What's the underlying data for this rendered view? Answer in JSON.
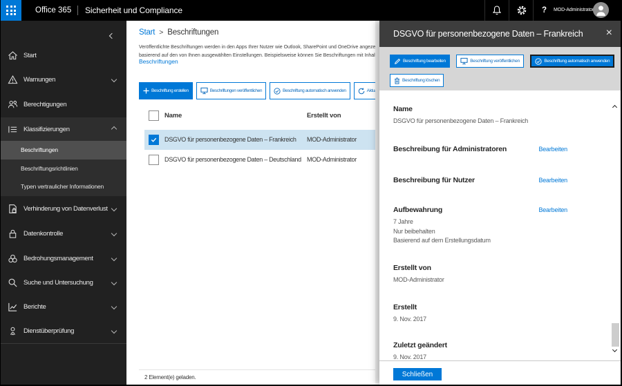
{
  "topbar": {
    "brand": "Office 365",
    "app_title": "Sicherheit und Compliance",
    "user_name": "MOD-Administrator",
    "help_label": "?"
  },
  "sidebar": {
    "items": [
      {
        "label": "Start"
      },
      {
        "label": "Warnungen"
      },
      {
        "label": "Berechtigungen"
      },
      {
        "label": "Klassifizierungen",
        "children": [
          {
            "label": "Beschriftungen"
          },
          {
            "label": "Beschriftungsrichtlinien"
          },
          {
            "label": "Typen vertraulicher Informationen"
          }
        ]
      },
      {
        "label": "Verhinderung von Datenverlust"
      },
      {
        "label": "Datenkontrolle"
      },
      {
        "label": "Bedrohungsmanagement"
      },
      {
        "label": "Suche und Untersuchung"
      },
      {
        "label": "Berichte"
      },
      {
        "label": "Dienstüberprüfung"
      }
    ]
  },
  "main": {
    "breadcrumb": {
      "home": "Start",
      "separator": ">",
      "current": "Beschriftungen"
    },
    "description_line1": "Veröffentlichte Beschriftungen werden in den Apps Ihrer Nutzer wie Outlook, SharePoint und OneDrive angezei",
    "description_line2": "basierend auf den von Ihnen ausgewählten Einstellungen. Beispielsweise können Sie Beschriftungen mit Inhalte",
    "learn_more_link": "Beschriftungen",
    "toolbar": {
      "create_label": "Beschriftung erstellen",
      "publish_label": "Beschriftungen veröffentlichen",
      "auto_apply_label": "Beschriftung automatisch anwenden",
      "refresh_label": "Aktualisieren"
    },
    "table": {
      "columns": [
        "Name",
        "Erstellt von"
      ],
      "rows": [
        {
          "name": "DSGVO für personenbezogene Daten – Frankreich",
          "created_by": "MOD-Administrator"
        },
        {
          "name": "DSGVO für personenbezogene Daten – Deutschland",
          "created_by": "MOD-Administrator"
        }
      ]
    },
    "status_text": "2 Element(e) geladen."
  },
  "panel": {
    "title": "DSGVO für personenbezogene Daten – Frankreich",
    "toolbar": {
      "edit_label": "Beschriftung bearbeiten",
      "publish_label": "Beschriftung veröffentlichen",
      "auto_apply_label": "Beschriftung automatisch anwenden",
      "delete_label": "Beschriftung löschen"
    },
    "sections": {
      "name": {
        "label": "Name",
        "value": "DSGVO für personenbezogene Daten – Frankreich"
      },
      "admin_desc": {
        "label": "Beschreibung für Administratoren",
        "action": "Bearbeiten"
      },
      "user_desc": {
        "label": "Beschreibung für Nutzer",
        "action": "Bearbeiten"
      },
      "retention": {
        "label": "Aufbewahrung",
        "action": "Bearbeiten",
        "line1": "7 Jahre",
        "line2": "Nur beibehalten",
        "line3": "Basierend auf dem Erstellungsdatum"
      },
      "created_by": {
        "label": "Erstellt von",
        "value": "MOD-Administrator"
      },
      "created": {
        "label": "Erstellt",
        "value": "9. Nov. 2017"
      },
      "modified": {
        "label": "Zuletzt geändert",
        "value": "9. Nov. 2017"
      }
    },
    "close_button": "Schließen"
  },
  "colors": {
    "accent": "#0078d7",
    "selected_row": "#cde3f1",
    "panel_header": "#3d3d3d",
    "panel_toolbar": "#d6d6d6"
  }
}
